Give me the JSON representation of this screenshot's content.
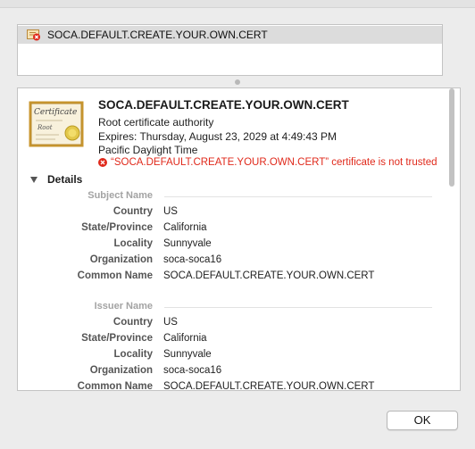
{
  "cert_list": {
    "item_label": "SOCA.DEFAULT.CREATE.YOUR.OWN.CERT",
    "item_icon": "certificate-invalid-icon"
  },
  "certificate": {
    "image_caption_top": "Certificate",
    "image_caption_bottom": "Root",
    "title": "SOCA.DEFAULT.CREATE.YOUR.OWN.CERT",
    "subtitle": "Root certificate authority",
    "expires": "Expires: Thursday, August 23, 2029 at 4:49:43 PM Pacific Daylight Time",
    "status": "“SOCA.DEFAULT.CREATE.YOUR.OWN.CERT” certificate is not trusted",
    "status_color": "#e0291b"
  },
  "details": {
    "toggle_label": "Details",
    "subject": {
      "heading": "Subject Name",
      "fields": [
        {
          "label": "Country",
          "value": "US"
        },
        {
          "label": "State/Province",
          "value": "California"
        },
        {
          "label": "Locality",
          "value": "Sunnyvale"
        },
        {
          "label": "Organization",
          "value": "soca-soca16"
        },
        {
          "label": "Common Name",
          "value": "SOCA.DEFAULT.CREATE.YOUR.OWN.CERT"
        }
      ]
    },
    "issuer": {
      "heading": "Issuer Name",
      "fields": [
        {
          "label": "Country",
          "value": "US"
        },
        {
          "label": "State/Province",
          "value": "California"
        },
        {
          "label": "Locality",
          "value": "Sunnyvale"
        },
        {
          "label": "Organization",
          "value": "soca-soca16"
        },
        {
          "label": "Common Name",
          "value": "SOCA.DEFAULT.CREATE.YOUR.OWN.CERT"
        }
      ]
    }
  },
  "buttons": {
    "ok_label": "OK"
  }
}
